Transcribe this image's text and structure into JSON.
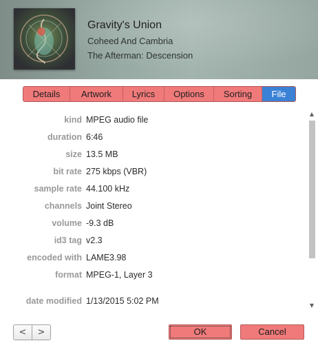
{
  "header": {
    "title": "Gravity's Union",
    "artist": "Coheed And Cambria",
    "album": "The Afterman: Descension",
    "artwork_icon": "album-artwork-image"
  },
  "tabs": [
    {
      "label": "Details",
      "active": false
    },
    {
      "label": "Artwork",
      "active": false
    },
    {
      "label": "Lyrics",
      "active": false
    },
    {
      "label": "Options",
      "active": false
    },
    {
      "label": "Sorting",
      "active": false
    },
    {
      "label": "File",
      "active": true
    }
  ],
  "file_info": [
    {
      "label": "kind",
      "value": "MPEG audio file"
    },
    {
      "label": "duration",
      "value": "6:46"
    },
    {
      "label": "size",
      "value": "13.5 MB"
    },
    {
      "label": "bit rate",
      "value": "275 kbps (VBR)"
    },
    {
      "label": "sample rate",
      "value": "44.100 kHz"
    },
    {
      "label": "channels",
      "value": "Joint Stereo"
    },
    {
      "label": "volume",
      "value": "-9.3 dB"
    },
    {
      "label": "id3 tag",
      "value": "v2.3"
    },
    {
      "label": "encoded with",
      "value": "LAME3.98"
    },
    {
      "label": "format",
      "value": "MPEG-1, Layer 3"
    },
    {
      "label": "date modified",
      "value": "1/13/2015 5:02 PM"
    }
  ],
  "scrollbar": {
    "up_icon": "chevron-up-icon",
    "down_icon": "chevron-down-icon",
    "up_glyph": "▲",
    "down_glyph": "▼"
  },
  "footer": {
    "prev_glyph": "<",
    "next_glyph": ">",
    "ok_label": "OK",
    "cancel_label": "Cancel"
  },
  "colors": {
    "tab": "#f07a7a",
    "tab_active": "#3b82d6",
    "label": "#999999"
  }
}
